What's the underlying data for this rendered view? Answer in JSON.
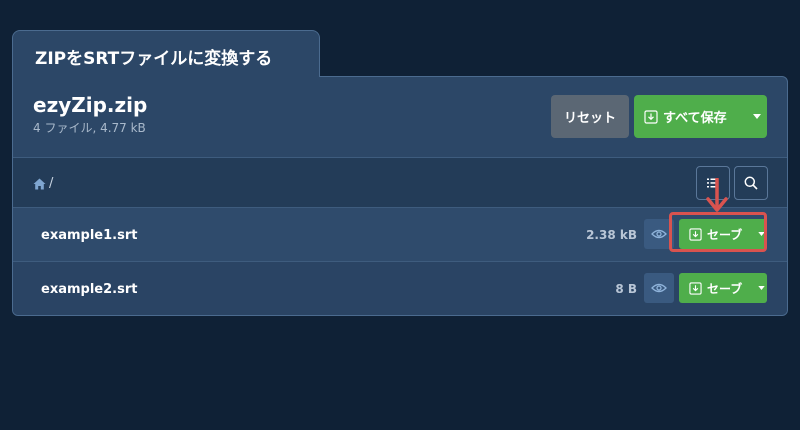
{
  "tab": {
    "title": "ZIPをSRTファイルに変換する"
  },
  "archive": {
    "name": "ezyZip.zip",
    "meta": "4 ファイル, 4.77 kB"
  },
  "actions": {
    "reset_label": "リセット",
    "save_all_label": "すべて保存"
  },
  "breadcrumb": {
    "separator": "/"
  },
  "files": [
    {
      "name": "example1.srt",
      "size": "2.38 kB",
      "save_label": "セーブ"
    },
    {
      "name": "example2.srt",
      "size": "8 B",
      "save_label": "セーブ"
    }
  ],
  "colors": {
    "background": "#0f2136",
    "panel": "#2c4767",
    "accent_green": "#4fae4b",
    "highlight_red": "#d9534f"
  }
}
